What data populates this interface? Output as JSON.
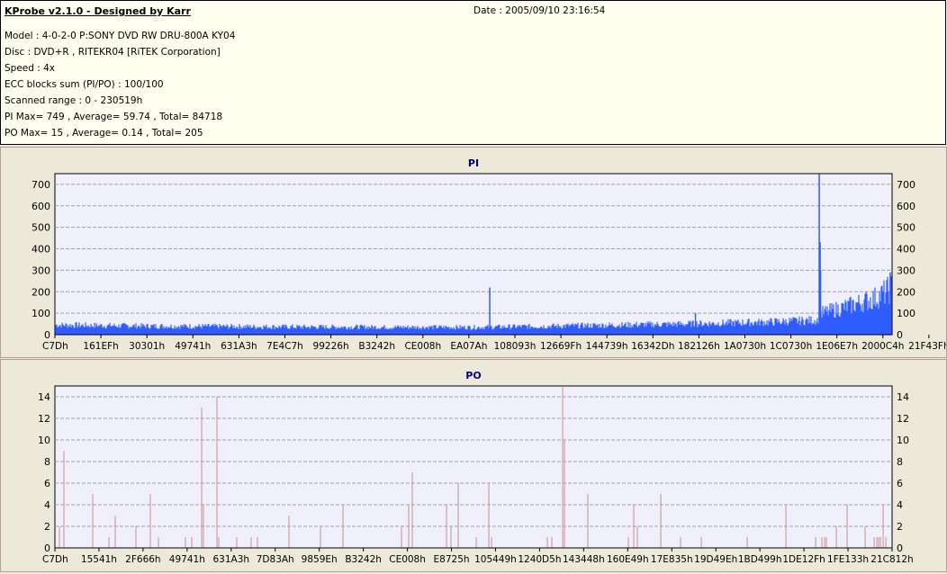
{
  "header": {
    "title": "KProbe v2.1.0 - Designed by Karr",
    "date": "Date : 2005/09/10 23:16:54",
    "lines": [
      "Model : 4-0-2-0 P:SONY    DVD RW DRU-800A  KY04",
      "Disc : DVD+R , RITEKR04 [RiTEK Corporation]",
      "Speed : 4x",
      "ECC blocks sum (PI/PO) : 100/100",
      "Scanned range : 0 - 230519h",
      "PI Max= 749 , Average= 59.74 , Total= 84718",
      "PO Max= 15 , Average= 0.14 , Total= 205"
    ]
  },
  "colors": {
    "pi": "#2f5cff",
    "po": "#c89090",
    "plot_bg": "#f0f0fc",
    "grid": "#a0a0a0",
    "title": "#000080"
  },
  "chart_data": [
    {
      "type": "bar",
      "title": "PI",
      "xmax": 2295065,
      "ylim": [
        0,
        750
      ],
      "yticks": [
        0,
        100,
        200,
        300,
        400,
        500,
        600,
        700
      ],
      "xticks": [
        "C7Dh",
        "161EFh",
        "30301h",
        "49741h",
        "631A3h",
        "7E4C7h",
        "99226h",
        "B3242h",
        "CE008h",
        "EA07Ah",
        "108093h",
        "12669Fh",
        "144739h",
        "16342Dh",
        "182126h",
        "1A0730h",
        "1C0730h",
        "1E06E7h",
        "2000C4h",
        "21F43Fh"
      ],
      "baseline": [
        [
          0,
          50
        ],
        [
          230000,
          45
        ],
        [
          690000,
          40
        ],
        [
          1150000,
          38
        ],
        [
          1380000,
          45
        ],
        [
          1720000,
          55
        ],
        [
          1950000,
          65
        ],
        [
          2090000,
          75
        ],
        [
          2100000,
          110
        ],
        [
          2180000,
          150
        ],
        [
          2250000,
          190
        ],
        [
          2295065,
          240
        ]
      ],
      "spikes": [
        [
          1192044,
          220
        ],
        [
          1756000,
          100
        ],
        [
          2095332,
          749
        ],
        [
          2097800,
          430
        ],
        [
          2099000,
          300
        ],
        [
          2290000,
          290
        ]
      ]
    },
    {
      "type": "bar",
      "title": "PO",
      "xmax": 2295065,
      "ylim": [
        0,
        15
      ],
      "yticks": [
        0,
        2,
        4,
        6,
        8,
        10,
        12,
        14
      ],
      "xticks": [
        "C7Dh",
        "15541h",
        "2F666h",
        "49741h",
        "631A3h",
        "7D83Ah",
        "9859Eh",
        "B3242h",
        "CE008h",
        "E8725h",
        "105449h",
        "1240D5h",
        "143448h",
        "160E49h",
        "17E835h",
        "19D49Eh",
        "1BD499h",
        "1DE12Fh",
        "1FE133h",
        "21C812h"
      ],
      "spikes": [
        [
          12340,
          2
        ],
        [
          24680,
          9
        ],
        [
          103656,
          5
        ],
        [
          148080,
          1
        ],
        [
          165356,
          3
        ],
        [
          222120,
          2
        ],
        [
          261608,
          5
        ],
        [
          283820,
          1
        ],
        [
          357860,
          1
        ],
        [
          375136,
          1
        ],
        [
          402284,
          13
        ],
        [
          407220,
          4
        ],
        [
          444240,
          14
        ],
        [
          449176,
          1
        ],
        [
          498536,
          1
        ],
        [
          538024,
          1
        ],
        [
          555300,
          1
        ],
        [
          641680,
          3
        ],
        [
          728060,
          2
        ],
        [
          789760,
          4
        ],
        [
          950180,
          2
        ],
        [
          969924,
          4
        ],
        [
          979796,
          7
        ],
        [
          1073580,
          4
        ],
        [
          1085920,
          2
        ],
        [
          1105664,
          6
        ],
        [
          1155024,
          1
        ],
        [
          1189576,
          6
        ],
        [
          1196980,
          1
        ],
        [
          1349996,
          1
        ],
        [
          1362336,
          1
        ],
        [
          1391952,
          15
        ],
        [
          1396888,
          10
        ],
        [
          1461056,
          5
        ],
        [
          1572116,
          1
        ],
        [
          1586924,
          4
        ],
        [
          1596796,
          2
        ],
        [
          1660964,
          5
        ],
        [
          1715260,
          1
        ],
        [
          1772024,
          1
        ],
        [
          1897892,
          1
        ],
        [
          2004016,
          4
        ],
        [
          2085460,
          1
        ],
        [
          2102736,
          1
        ],
        [
          2110140,
          1
        ],
        [
          2115076,
          1
        ],
        [
          2142224,
          2
        ],
        [
          2171840,
          4
        ],
        [
          2221200,
          2
        ],
        [
          2245880,
          1
        ],
        [
          2253284,
          1
        ],
        [
          2258220,
          1
        ],
        [
          2263156,
          1
        ],
        [
          2270560,
          4
        ],
        [
          2277964,
          1
        ]
      ]
    }
  ]
}
